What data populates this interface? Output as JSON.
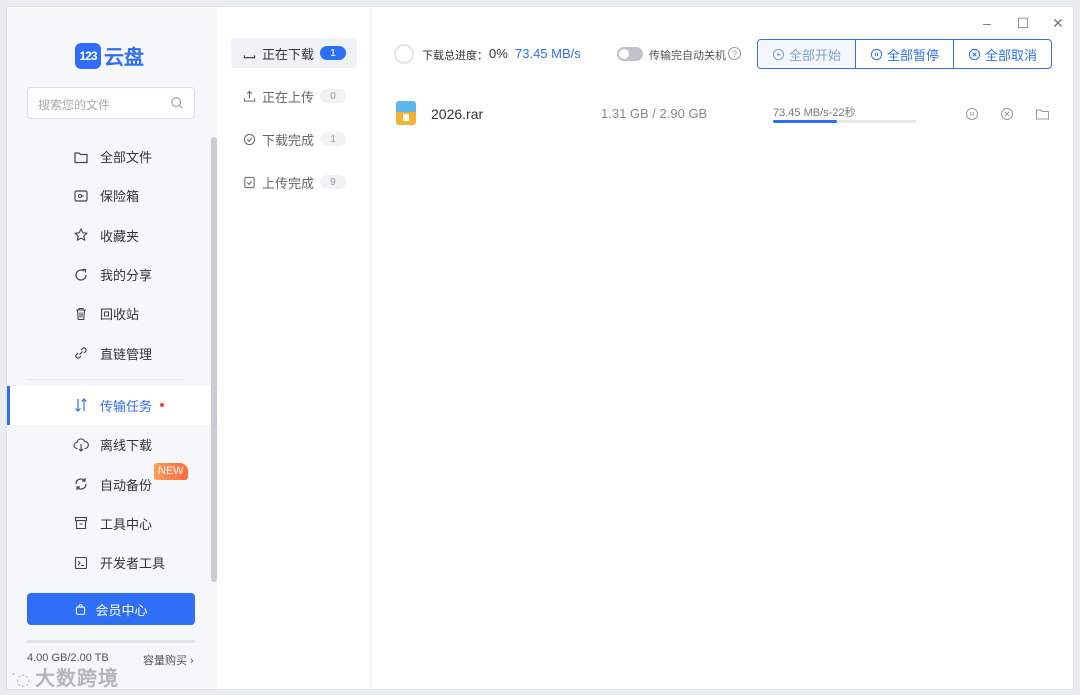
{
  "app": {
    "logo_badge": "123",
    "logo_text": "云盘"
  },
  "search": {
    "placeholder": "搜索您的文件",
    "icon": "search-icon"
  },
  "sidebar": {
    "items": [
      {
        "label": "全部文件",
        "icon": "folder-icon"
      },
      {
        "label": "保险箱",
        "icon": "safe-icon"
      },
      {
        "label": "收藏夹",
        "icon": "star-icon"
      },
      {
        "label": "我的分享",
        "icon": "share-icon"
      },
      {
        "label": "回收站",
        "icon": "trash-icon"
      },
      {
        "label": "直链管理",
        "icon": "link-icon"
      },
      {
        "label": "传输任务",
        "icon": "transfer-icon",
        "active": true
      },
      {
        "label": "离线下载",
        "icon": "cloud-download-icon"
      },
      {
        "label": "自动备份",
        "icon": "sync-icon",
        "badge": "NEW"
      },
      {
        "label": "工具中心",
        "icon": "toolbox-icon"
      },
      {
        "label": "开发者工具",
        "icon": "terminal-icon"
      }
    ],
    "vip_label": "会员中心",
    "quota_text": "4.00 GB/2.00 TB",
    "quota_buy": "容量购买 ›",
    "quota_used_fraction": 0.002,
    "watermark": "大数跨境"
  },
  "tabs": [
    {
      "label": "正在下载",
      "count": "1",
      "icon": "download-tray-icon",
      "active": true
    },
    {
      "label": "正在上传",
      "count": "0",
      "icon": "upload-icon"
    },
    {
      "label": "下载完成",
      "count": "1",
      "icon": "check-circle-icon"
    },
    {
      "label": "上传完成",
      "count": "9",
      "icon": "check-doc-icon"
    }
  ],
  "toolbar": {
    "total_label": "下载总进度：",
    "total_pct": "0%",
    "total_speed": "73.45 MB/s",
    "auto_shutdown_label": "传输完自动关机",
    "auto_shutdown_on": false,
    "help": "?",
    "start_all": "全部开始",
    "pause_all": "全部暂停",
    "cancel_all": "全部取消"
  },
  "window": {
    "minimize": "–",
    "maximize": "☐",
    "close": "✕"
  },
  "download": {
    "name": "2026.rar",
    "size": "1.31 GB / 2.90 GB",
    "speed": "73.45 MB/s-22秒",
    "progress": 0.45
  },
  "colors": {
    "accent": "#2f6ff5",
    "red_dot": "#f5423b"
  }
}
